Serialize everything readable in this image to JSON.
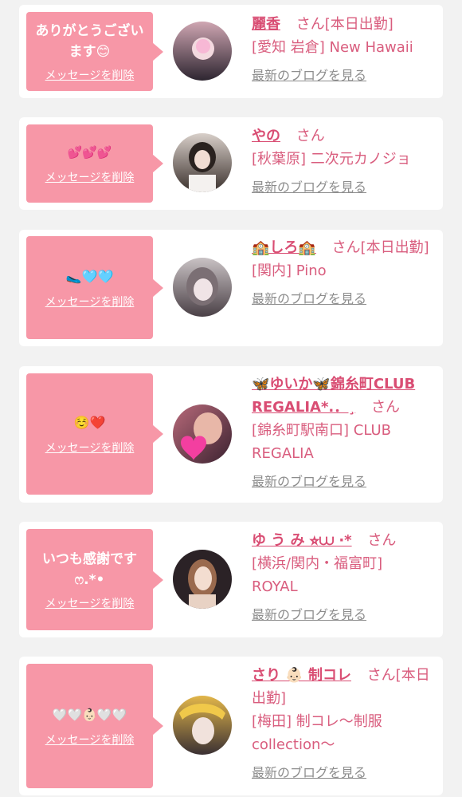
{
  "delete_label": "メッセージを削除",
  "blog_label": "最新のブログを見る",
  "cards": [
    {
      "message": "ありがとうございます😊",
      "name": "麗香",
      "suffix": "さん[本日出勤]",
      "shop": "[愛知 岩倉] New Hawaii",
      "avatar_colors": [
        "#cfa6b2",
        "#2d2530"
      ]
    },
    {
      "message": "💕💕💕",
      "name": "やの",
      "suffix": "さん",
      "shop": "[秋葉原] 二次元カノジョ",
      "avatar_colors": [
        "#d8cfc9",
        "#3a302c"
      ]
    },
    {
      "message": "🥿🩵🩵",
      "name": "🏫しろ🏫",
      "suffix": "さん[本日出勤]",
      "shop": "[関内] Pino",
      "avatar_colors": [
        "#c9c2c4",
        "#4a4046"
      ]
    },
    {
      "message": "☺️❤️",
      "name": "🦋ゆいか🦋錦糸町CLUB REGALIA*.．¸",
      "suffix": "さん",
      "shop": "[錦糸町駅南口] CLUB REGALIA",
      "avatar_colors": [
        "#b86a7a",
        "#3b2230"
      ]
    },
    {
      "message": "いつも感謝です ෆ.*•",
      "name": "ゆ う み ⭐︎⩊ ·*",
      "suffix": "さん",
      "shop": "[横浜/関内・福富町] ROYAL",
      "avatar_colors": [
        "#d9b89d",
        "#2b2226"
      ]
    },
    {
      "message": "🤍🤍👶🏻🤍🤍",
      "name": "さり 👶🏻 制コレ",
      "suffix": "さん[本日出勤]",
      "shop": "[梅田] 制コレ〜制服collection〜",
      "avatar_colors": [
        "#e2b64a",
        "#3a3033"
      ]
    }
  ]
}
